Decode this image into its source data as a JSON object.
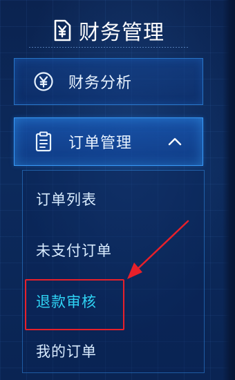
{
  "header": {
    "title": "财务管理",
    "icon": "yen-document-icon"
  },
  "menu": {
    "finance": {
      "label": "财务分析",
      "icon": "yen-circle-icon"
    },
    "orders": {
      "label": "订单管理",
      "icon": "clipboard-icon",
      "expanded": true,
      "chevron": "chevron-up-icon"
    }
  },
  "submenu": {
    "items": [
      {
        "label": "订单列表"
      },
      {
        "label": "未支付订单"
      },
      {
        "label": "退款审核",
        "active": true
      },
      {
        "label": "我的订单"
      }
    ]
  },
  "colors": {
    "background": "#0c2a5c",
    "accent": "#2fd4f5",
    "highlight": "#e8202a"
  }
}
